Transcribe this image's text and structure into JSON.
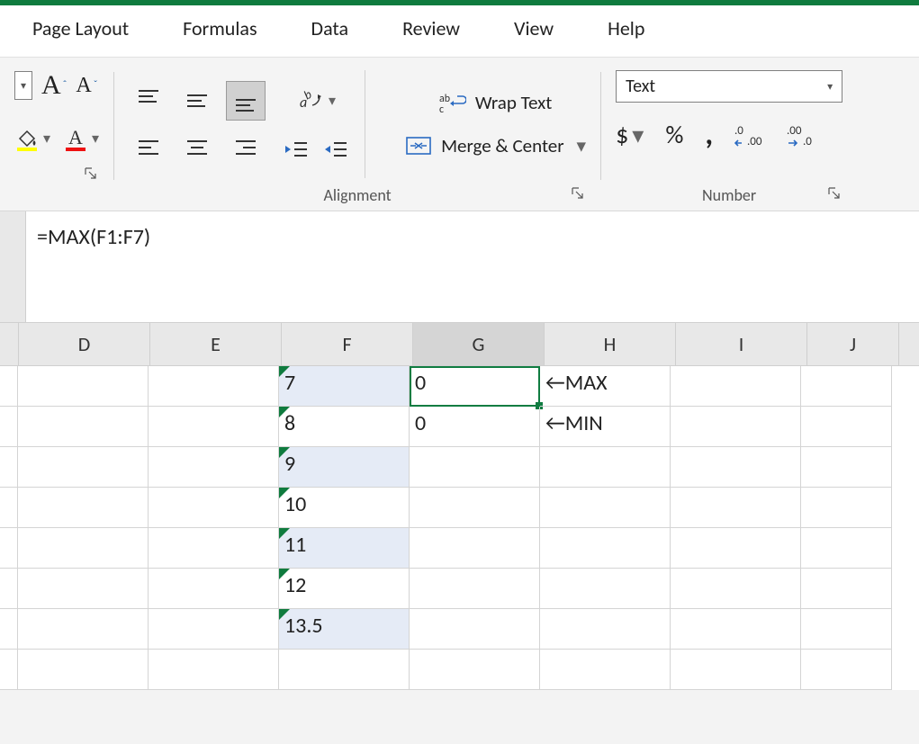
{
  "tabs": {
    "pageLayout": "Page Layout",
    "formulas": "Formulas",
    "data": "Data",
    "review": "Review",
    "view": "View",
    "help": "Help"
  },
  "ribbon": {
    "wrapText": "Wrap Text",
    "mergeCenter": "Merge & Center",
    "numberFormat": "Text",
    "groupAlignment": "Alignment",
    "groupNumber": "Number",
    "dollar": "$",
    "percent": "%",
    "comma": ","
  },
  "formulaBar": {
    "value": "=MAX(F1:F7)"
  },
  "columns": [
    "D",
    "E",
    "F",
    "G",
    "H",
    "I",
    "J"
  ],
  "sheet": {
    "F": [
      "7",
      "8",
      "9",
      "10",
      "11",
      "12",
      "13.5"
    ],
    "G": [
      "0",
      "0"
    ],
    "H": [
      "←MAX",
      "←MIN"
    ]
  },
  "activeCell": "G1",
  "selectedColumn": "G"
}
